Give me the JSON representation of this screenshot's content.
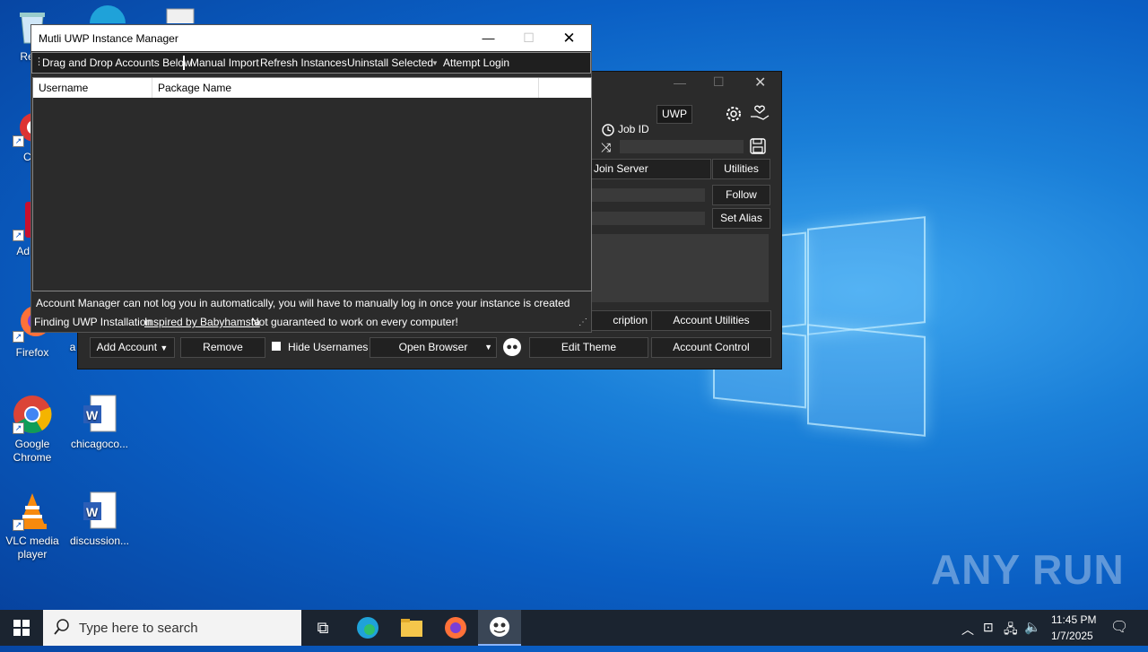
{
  "desktop": {
    "icons": [
      {
        "label": "Recy",
        "glyph": "recycle-bin-icon"
      },
      {
        "label": "CCl",
        "glyph": "ccleaner-icon"
      },
      {
        "label": "Ad Acr",
        "glyph": "acrobat-icon"
      },
      {
        "label": "Firefox",
        "glyph": "firefox-icon"
      },
      {
        "label": "Google Chrome",
        "glyph": "chrome-icon"
      },
      {
        "label": "chicagoco...",
        "glyph": "word-doc-icon"
      },
      {
        "label": "VLC media player",
        "glyph": "vlc-icon"
      },
      {
        "label": "discussion...",
        "glyph": "word-doc-icon"
      },
      {
        "label": "a",
        "glyph": ""
      }
    ],
    "watermark": "ANY RUN"
  },
  "back_window": {
    "uwp_label": "UWP",
    "job_id_label": "Job ID",
    "join_server": "Join Server",
    "utilities": "Utilities",
    "follow": "Follow",
    "set_alias": "Set Alias",
    "description_partial": "cription",
    "account_utilities": "Account Utilities",
    "add_account": "Add Account",
    "remove": "Remove",
    "hide_usernames": "Hide Usernames",
    "open_browser": "Open Browser",
    "edit_theme": "Edit Theme",
    "account_control": "Account Control"
  },
  "front_window": {
    "title": "Mutli UWP Instance Manager",
    "menu": {
      "drag_drop": "Drag and Drop Accounts Below",
      "manual_import": "Manual Import",
      "refresh": "Refresh Instances",
      "uninstall": "Uninstall Selected",
      "attempt_login": "Attempt Login"
    },
    "columns": [
      "Username",
      "Package Name",
      ""
    ],
    "status_line1": "Account Manager can not log you in automatically, you will have to manually log in once your instance is created",
    "status_finding": "Finding UWP Installation",
    "status_inspired": "Inspired by Babyhamsta",
    "status_warning": "Not guaranteed to work on every computer!"
  },
  "taskbar": {
    "search_placeholder": "Type here to search",
    "time": "11:45 PM",
    "date": "1/7/2025"
  }
}
